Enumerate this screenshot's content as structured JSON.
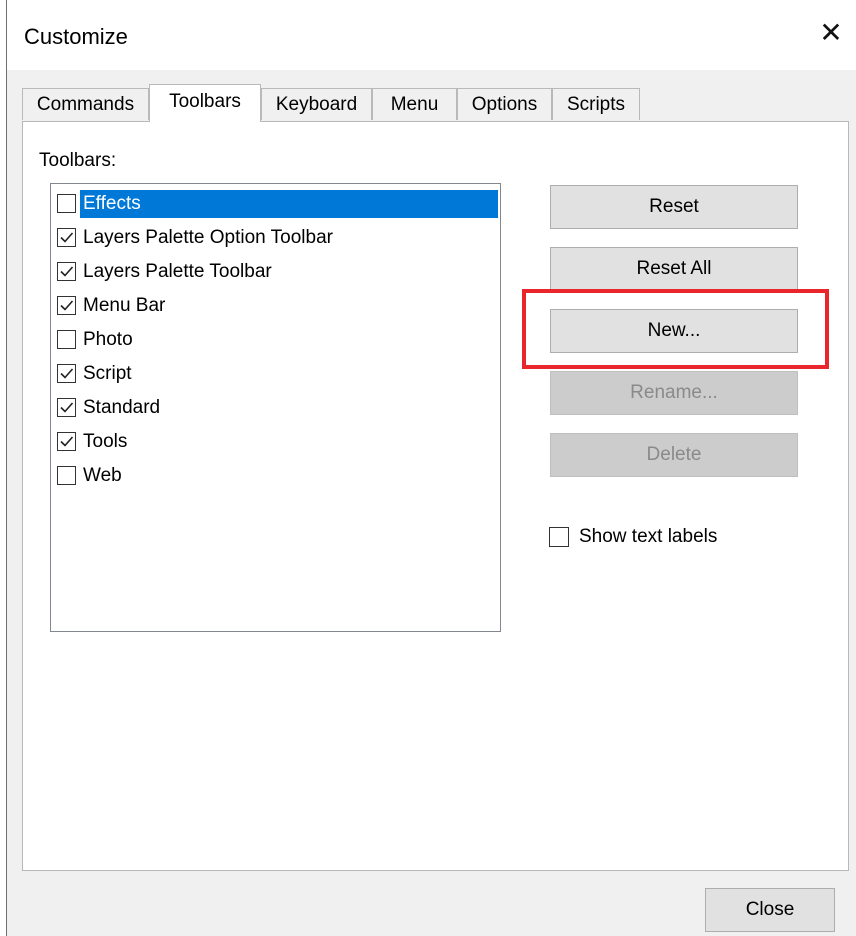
{
  "window": {
    "title": "Customize",
    "close_glyph": "✕"
  },
  "tabs": [
    {
      "label": "Commands",
      "active": false
    },
    {
      "label": "Toolbars",
      "active": true
    },
    {
      "label": "Keyboard",
      "active": false
    },
    {
      "label": "Menu",
      "active": false
    },
    {
      "label": "Options",
      "active": false
    },
    {
      "label": "Scripts",
      "active": false
    }
  ],
  "toolbars_panel": {
    "list_label": "Toolbars:",
    "items": [
      {
        "label": "Effects",
        "checked": false,
        "selected": true
      },
      {
        "label": "Layers Palette Option Toolbar",
        "checked": true,
        "selected": false
      },
      {
        "label": "Layers Palette Toolbar",
        "checked": true,
        "selected": false
      },
      {
        "label": "Menu Bar",
        "checked": true,
        "selected": false
      },
      {
        "label": "Photo",
        "checked": false,
        "selected": false
      },
      {
        "label": "Script",
        "checked": true,
        "selected": false
      },
      {
        "label": "Standard",
        "checked": true,
        "selected": false
      },
      {
        "label": "Tools",
        "checked": true,
        "selected": false
      },
      {
        "label": "Web",
        "checked": false,
        "selected": false
      }
    ],
    "buttons": {
      "reset": "Reset",
      "reset_all": "Reset All",
      "new": "New...",
      "rename": "Rename...",
      "delete": "Delete"
    },
    "show_text_labels": {
      "label": "Show text labels",
      "checked": false
    }
  },
  "footer": {
    "close_label": "Close"
  },
  "colors": {
    "selection": "#0078d7",
    "highlight_annotation": "#e8262b"
  }
}
